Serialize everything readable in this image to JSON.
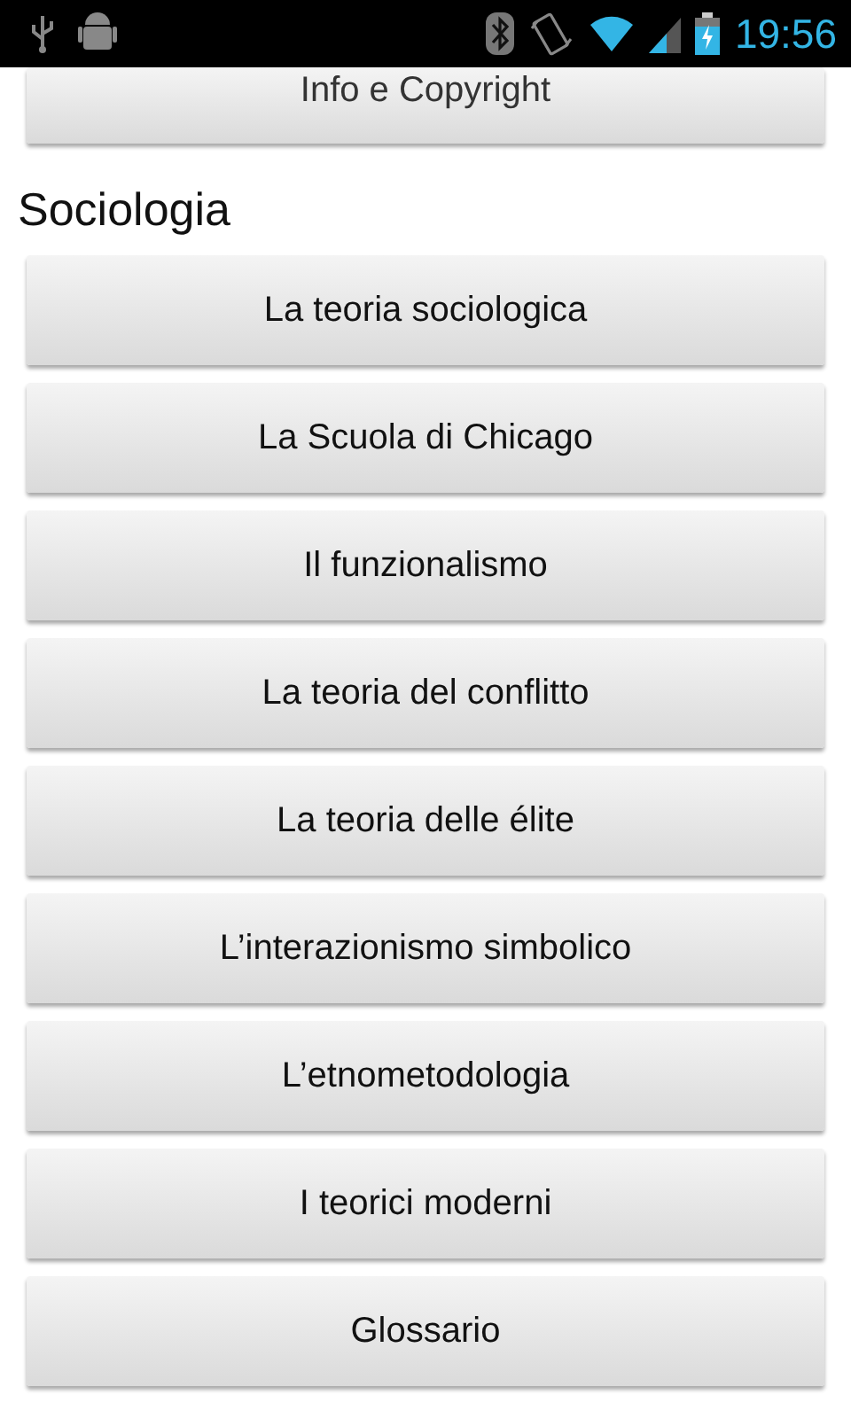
{
  "status_bar": {
    "time": "19:56"
  },
  "top_button": {
    "label": "Info e Copyright"
  },
  "section": {
    "title": "Sociologia",
    "buttons": [
      {
        "label": "La teoria sociologica"
      },
      {
        "label": "La Scuola di Chicago"
      },
      {
        "label": "Il funzionalismo"
      },
      {
        "label": "La teoria del conflitto"
      },
      {
        "label": "La teoria delle élite"
      },
      {
        "label": "L’interazionismo simbolico"
      },
      {
        "label": "L’etnometodologia"
      },
      {
        "label": "I teorici moderni"
      },
      {
        "label": "Glossario"
      }
    ]
  }
}
